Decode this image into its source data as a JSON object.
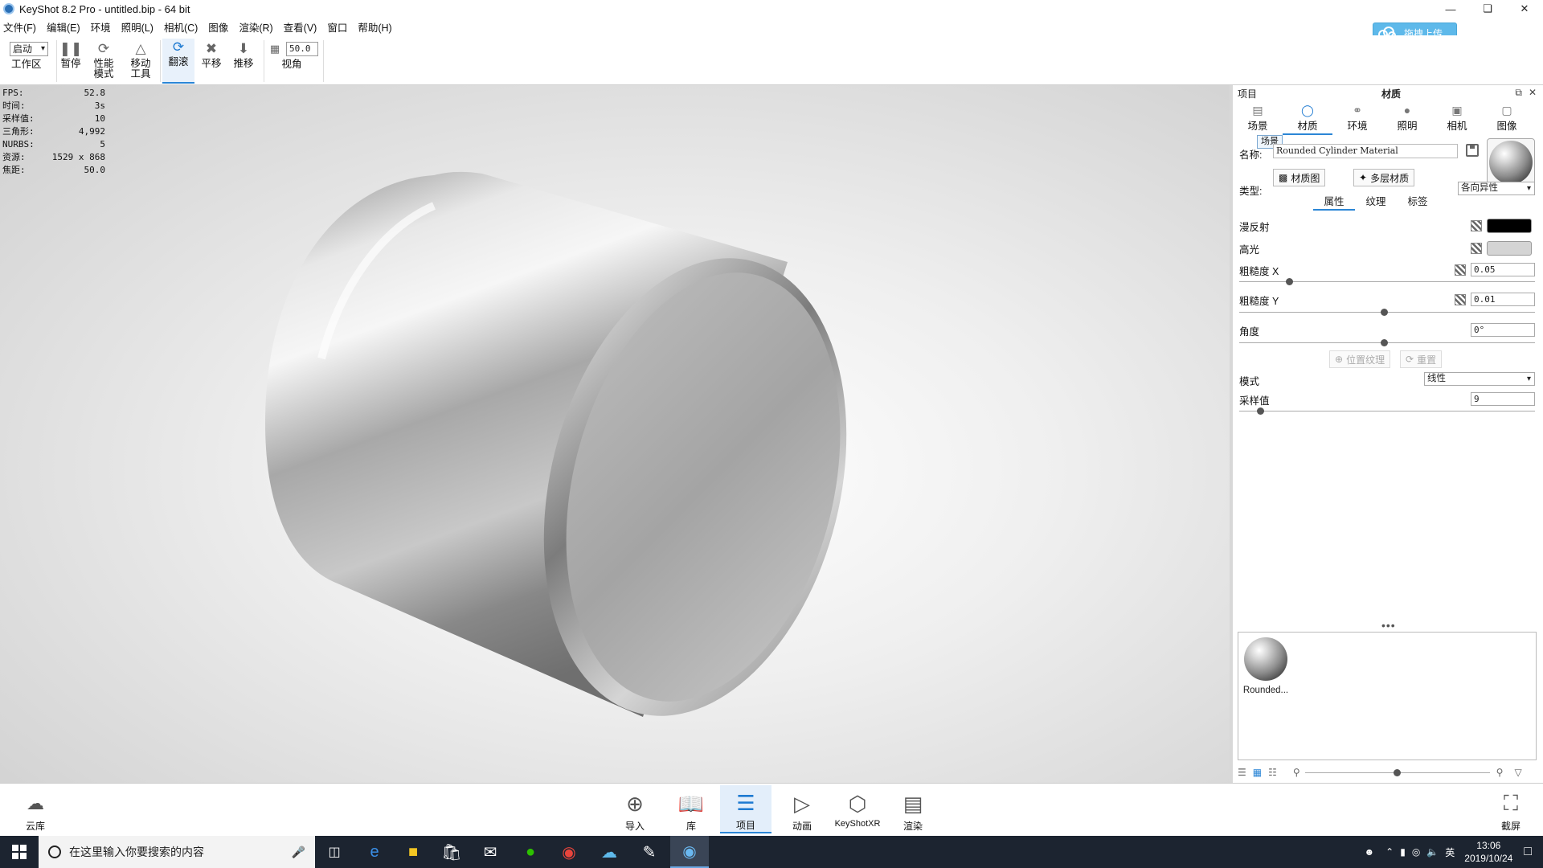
{
  "window": {
    "title": "KeyShot 8.2 Pro  - untitled.bip  - 64 bit"
  },
  "menu": [
    "文件(F)",
    "编辑(E)",
    "环境",
    "照明(L)",
    "相机(C)",
    "图像",
    "渲染(R)",
    "查看(V)",
    "窗口",
    "帮助(H)"
  ],
  "upload_button": "拖拽上传",
  "toolbar": {
    "startup_value": "启动",
    "workspace": "工作区",
    "pause": "暂停",
    "perf_mode_1": "性能",
    "perf_mode_2": "模式",
    "move_tool_1": "移动",
    "move_tool_2": "工具",
    "tumble": "翻滚",
    "pan": "平移",
    "dolly": "推移",
    "fov_value": "50.0",
    "fov_label": "视角"
  },
  "stats": [
    {
      "label": "FPS:",
      "value": "52.8"
    },
    {
      "label": "时间:",
      "value": "3s"
    },
    {
      "label": "采样值:",
      "value": "10"
    },
    {
      "label": "三角形:",
      "value": "4,992"
    },
    {
      "label": "NURBS:",
      "value": "5"
    },
    {
      "label": "资源:",
      "value": "1529 x 868"
    },
    {
      "label": "焦距:",
      "value": "50.0"
    }
  ],
  "panel": {
    "header_left": "项目",
    "header_title": "材质",
    "tabs": [
      "场景",
      "材质",
      "环境",
      "照明",
      "相机",
      "图像"
    ],
    "tooltip": "场景",
    "name_label": "名称:",
    "name_value": "Rounded Cylinder Material",
    "material_graph": "材质图",
    "multi_material": "多层材质",
    "type_label": "类型:",
    "type_value": "各向异性",
    "subtabs": [
      "属性",
      "纹理",
      "标签"
    ],
    "diffuse_label": "漫反射",
    "diffuse_color": "#000000",
    "specular_label": "高光",
    "specular_color": "#d4d4d4",
    "roughness_x_label": "粗糙度 X",
    "roughness_x_value": "0.05",
    "roughness_y_label": "粗糙度 Y",
    "roughness_y_value": "0.01",
    "angle_label": "角度",
    "angle_value": "0°",
    "position_texture": "位置纹理",
    "reset": "重置",
    "mode_label": "模式",
    "mode_value": "线性",
    "samples_label": "采样值",
    "samples_value": "9",
    "library_item": "Rounded..."
  },
  "bottom": {
    "cloud": "云库",
    "import": "导入",
    "library": "库",
    "project": "项目",
    "animation": "动画",
    "keyshotxr": "KeyShotXR",
    "render": "渲染",
    "screenshot": "截屏"
  },
  "taskbar": {
    "search_placeholder": "在这里输入你要搜索的内容",
    "ime": "英",
    "time": "13:06",
    "date": "2019/10/24"
  }
}
